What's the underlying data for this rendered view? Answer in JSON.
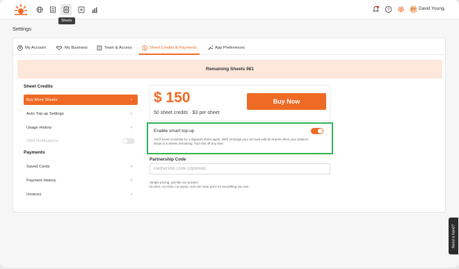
{
  "topbar": {
    "tooltip": "Sheets",
    "user_name": "David Young",
    "user_initials": "DY",
    "brand_color": "#ef6a25",
    "icons": [
      "globe-icon",
      "document-list-icon",
      "sheets-icon",
      "add-sheet-icon",
      "chart-icon"
    ],
    "right_icons": [
      "bell-icon",
      "help-icon",
      "gear-icon"
    ]
  },
  "page": {
    "title": "Settings"
  },
  "tabs": [
    {
      "label": "My Account",
      "icon": "user-icon"
    },
    {
      "label": "My Business",
      "icon": "handshake-icon"
    },
    {
      "label": "Team & Access",
      "icon": "team-icon"
    },
    {
      "label": "Sheet Credits & Payments",
      "icon": "dollar-icon",
      "active": true
    },
    {
      "label": "App Preferences",
      "icon": "wrench-icon"
    }
  ],
  "banner": {
    "text": "Remaining Sheets 981"
  },
  "sidebar": {
    "credits_heading": "Sheet Credits",
    "credit_items": [
      {
        "label": "Buy More Sheets",
        "active": true
      },
      {
        "label": "Auto Top-up Settings"
      },
      {
        "label": "Usage History"
      },
      {
        "label": "SMS Notifications",
        "disabled": true
      }
    ],
    "payments_heading": "Payments",
    "payment_items": [
      {
        "label": "Saved Cards"
      },
      {
        "label": "Payment History"
      },
      {
        "label": "Invoices"
      }
    ]
  },
  "purchase": {
    "price": "$ 150",
    "description": "50 sheet credits · $3 per sheet",
    "buy_label": "Buy Now"
  },
  "smart_topup": {
    "title": "Enable smart top-up",
    "description": "You'll never scramble for a daywork sheet again. We'll recharge your account with 50 sheets when your balance drops to 5 sheets remaining. Turn this off any time.",
    "enabled": true
  },
  "partnership": {
    "label": "Partnership Code",
    "placeholder": "Partnership Code (Optional)",
    "value": ""
  },
  "note": {
    "line1": "Simple pricing, just like our product.",
    "line2": "No tiers, no tricks, no expiry. Just one clear price for everything you see."
  },
  "help": {
    "label": "Need a hand?"
  }
}
